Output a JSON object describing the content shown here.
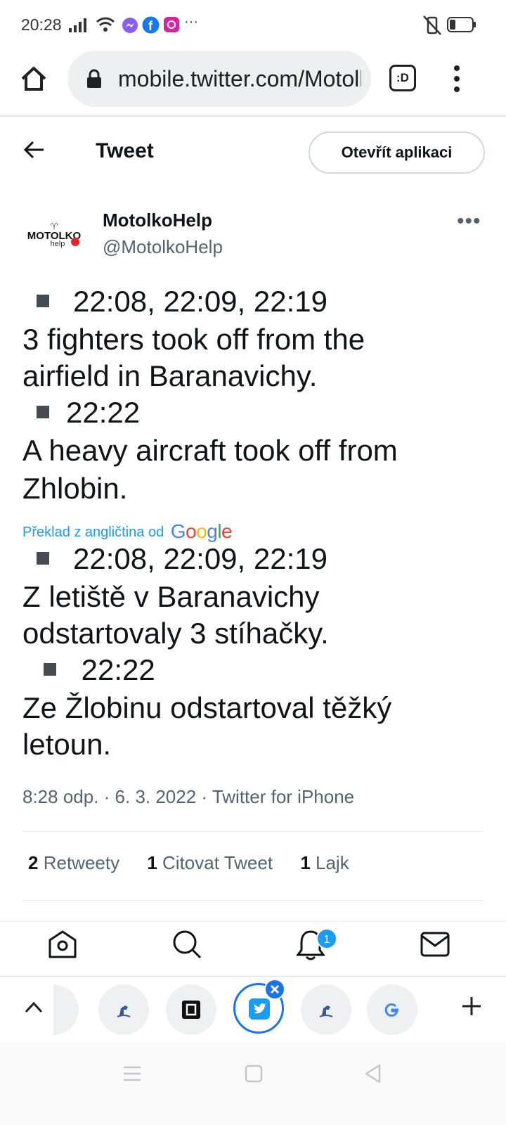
{
  "status_bar": {
    "time": "20:28",
    "overflow": "···"
  },
  "browser": {
    "url": "mobile.twitter.com/MotolkoHelp",
    "tab_switcher": ":D"
  },
  "header": {
    "title": "Tweet",
    "open_app": "Otevřít aplikaci"
  },
  "author": {
    "name": "MotolkoHelp",
    "handle": "@MotolkoHelp",
    "avatar_word": "MOTOLKO",
    "avatar_sub": "help"
  },
  "tweet": {
    "original": [
      {
        "kind": "bullet",
        "text": "22:08, 22:09, 22:19"
      },
      {
        "kind": "text",
        "text": "3 fighters took off from the"
      },
      {
        "kind": "text",
        "text": "airfield in Baranavichy."
      },
      {
        "kind": "bullet",
        "text": "22:22"
      },
      {
        "kind": "text",
        "text": "A heavy aircraft took off from"
      },
      {
        "kind": "text",
        "text": "Zhlobin."
      }
    ],
    "translation_label": "Překlad z angličtina od",
    "translation_provider": "Google",
    "translated": [
      {
        "kind": "bullet",
        "text": "22:08, 22:09, 22:19"
      },
      {
        "kind": "text",
        "text": " Z letiště v Baranavichy"
      },
      {
        "kind": "text",
        "text": "odstartovaly 3 stíhačky."
      },
      {
        "kind": "bullet",
        "text": " 22:22"
      },
      {
        "kind": "text",
        "text": " Ze Žlobinu odstartoval těžký"
      },
      {
        "kind": "text",
        "text": "letoun."
      }
    ],
    "meta": "8:28 odp. · 6. 3. 2022 · Twitter for iPhone"
  },
  "stats": {
    "retweets_count": "2",
    "retweets_label": "Retweety",
    "quotes_count": "1",
    "quotes_label": "Citovat Tweet",
    "likes_count": "1",
    "likes_label": "Lajk"
  },
  "twitter_nav": {
    "notifications_badge": "1"
  },
  "colors": {
    "twitter_blue": "#1d9bf0",
    "text": "#0f1419",
    "muted": "#536471"
  }
}
